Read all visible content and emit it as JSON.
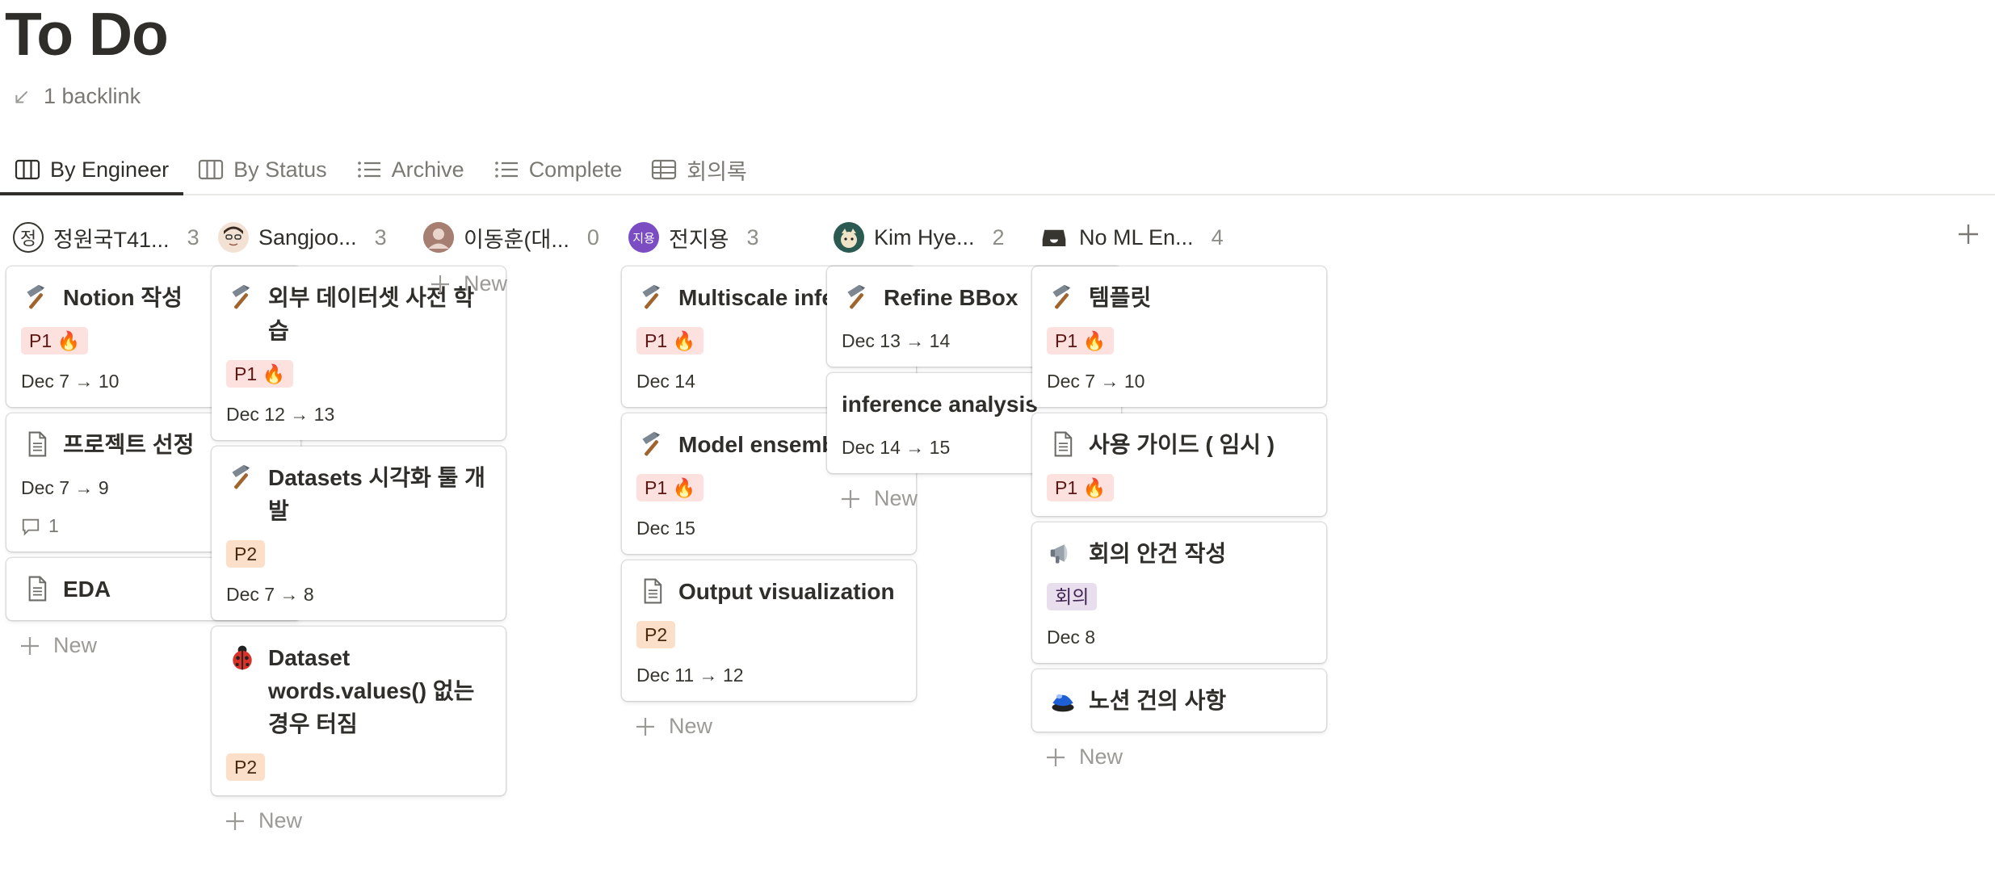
{
  "page": {
    "title": "To Do",
    "backlink": "1 backlink"
  },
  "tabs": [
    {
      "label": "By Engineer",
      "icon": "board-icon",
      "active": true
    },
    {
      "label": "By Status",
      "icon": "board-icon"
    },
    {
      "label": "Archive",
      "icon": "list-icon"
    },
    {
      "label": "Complete",
      "icon": "list-icon"
    },
    {
      "label": "회의록",
      "icon": "table-icon"
    }
  ],
  "new_label": "New",
  "columns": [
    {
      "name": "정원국T41...",
      "count": "3",
      "avatar_text": "정",
      "cards": [
        {
          "icon": "hammer-icon",
          "title": "Notion 작성",
          "tag": "P1 🔥",
          "tag_type": "p1",
          "date": "Dec 7 → 10"
        },
        {
          "icon": "document-icon",
          "title": "프로젝트 선정",
          "date": "Dec 7 → 9",
          "comments": "1"
        },
        {
          "icon": "document-icon",
          "title": "EDA"
        }
      ]
    },
    {
      "name": "Sangjoo...",
      "count": "3",
      "avatar_text": "",
      "cards": [
        {
          "icon": "hammer-icon",
          "title": "외부 데이터셋 사전 학습",
          "tag": "P1 🔥",
          "tag_type": "p1",
          "date": "Dec 12 → 13"
        },
        {
          "icon": "hammer-icon",
          "title": "Datasets 시각화 툴 개발",
          "tag": "P2",
          "tag_type": "p2",
          "date": "Dec 7 → 8"
        },
        {
          "icon": "ladybug-icon",
          "title": "Dataset words.values() 없는 경우 터짐",
          "tag": "P2",
          "tag_type": "p2"
        }
      ]
    },
    {
      "name": "이동훈(대...",
      "count": "0",
      "avatar_text": "",
      "cards": []
    },
    {
      "name": "전지용",
      "count": "3",
      "avatar_text": "지용",
      "cards": [
        {
          "icon": "hammer-icon",
          "title": " Multiscale inference",
          "tag": "P1 🔥",
          "tag_type": "p1",
          "date": "Dec 14"
        },
        {
          "icon": "hammer-icon",
          "title": "Model ensemble",
          "tag": "P1 🔥",
          "tag_type": "p1",
          "date": "Dec 15"
        },
        {
          "icon": "document-icon",
          "title": "Output visualization",
          "tag": "P2",
          "tag_type": "p2",
          "date": "Dec 11 → 12"
        }
      ]
    },
    {
      "name": "Kim Hye...",
      "count": "2",
      "avatar_text": "",
      "cards": [
        {
          "icon": "hammer-icon",
          "title": "Refine BBox",
          "date": "Dec 13 → 14"
        },
        {
          "icon": "",
          "title": "inference analysis",
          "date": "Dec 14 → 15"
        }
      ]
    },
    {
      "name": "No ML En...",
      "count": "4",
      "avatar_text": "",
      "cards": [
        {
          "icon": "hammer-icon",
          "title": "템플릿",
          "tag": "P1 🔥",
          "tag_type": "p1",
          "date": "Dec 7 → 10"
        },
        {
          "icon": "document-icon",
          "title": "사용 가이드 ( 임시 )",
          "tag": "P1 🔥",
          "tag_type": "p1"
        },
        {
          "icon": "megaphone-icon",
          "title": "회의 안건 작성",
          "tag": "회의",
          "tag_type": "meet",
          "date": "Dec 8"
        },
        {
          "icon": "buzzer-icon",
          "title": "노션 건의 사항"
        }
      ]
    }
  ]
}
